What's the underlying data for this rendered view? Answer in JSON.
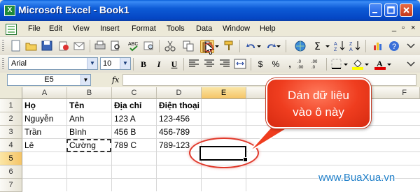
{
  "window": {
    "title": "Microsoft Excel - Book1",
    "app_icon": "X",
    "controls": [
      "minimize-icon",
      "maximize-icon",
      "close-icon"
    ]
  },
  "menubar": {
    "items": [
      "File",
      "Edit",
      "View",
      "Insert",
      "Format",
      "Tools",
      "Data",
      "Window",
      "Help"
    ],
    "doc_controls": [
      "_",
      "▫",
      "×"
    ]
  },
  "format_toolbar": {
    "font": "Arial",
    "size": "10",
    "bold": "B",
    "italic": "I",
    "underline": "U",
    "currency": "$",
    "percent": "%",
    "comma": ","
  },
  "formula_bar": {
    "name_box": "E5",
    "fx": "fx",
    "formula": ""
  },
  "grid": {
    "columns": [
      "A",
      "B",
      "C",
      "D",
      "E"
    ],
    "partial_column": "F",
    "active_column": "E",
    "rows": [
      "1",
      "2",
      "3",
      "4",
      "5",
      "6",
      "7"
    ],
    "active_row": "5",
    "cells": [
      [
        "Họ",
        "Tên",
        "Địa chỉ",
        "Điện thoại"
      ],
      [
        "Nguyễn",
        "Anh",
        "123 A",
        "123-456"
      ],
      [
        "Trần",
        "Bình",
        "456 B",
        "456-789"
      ],
      [
        "Lê",
        "Cường",
        "789 C",
        "789-123"
      ]
    ]
  },
  "callout": {
    "line1": "Dán dữ liệu",
    "line2": "vào ô này"
  },
  "watermark": "www.BuaXua.vn",
  "colors": {
    "titlebar": "#0546c4",
    "callout": "#ef3d1f",
    "highlight_ring": "#e0382a",
    "watermark": "#1e7ec8"
  }
}
